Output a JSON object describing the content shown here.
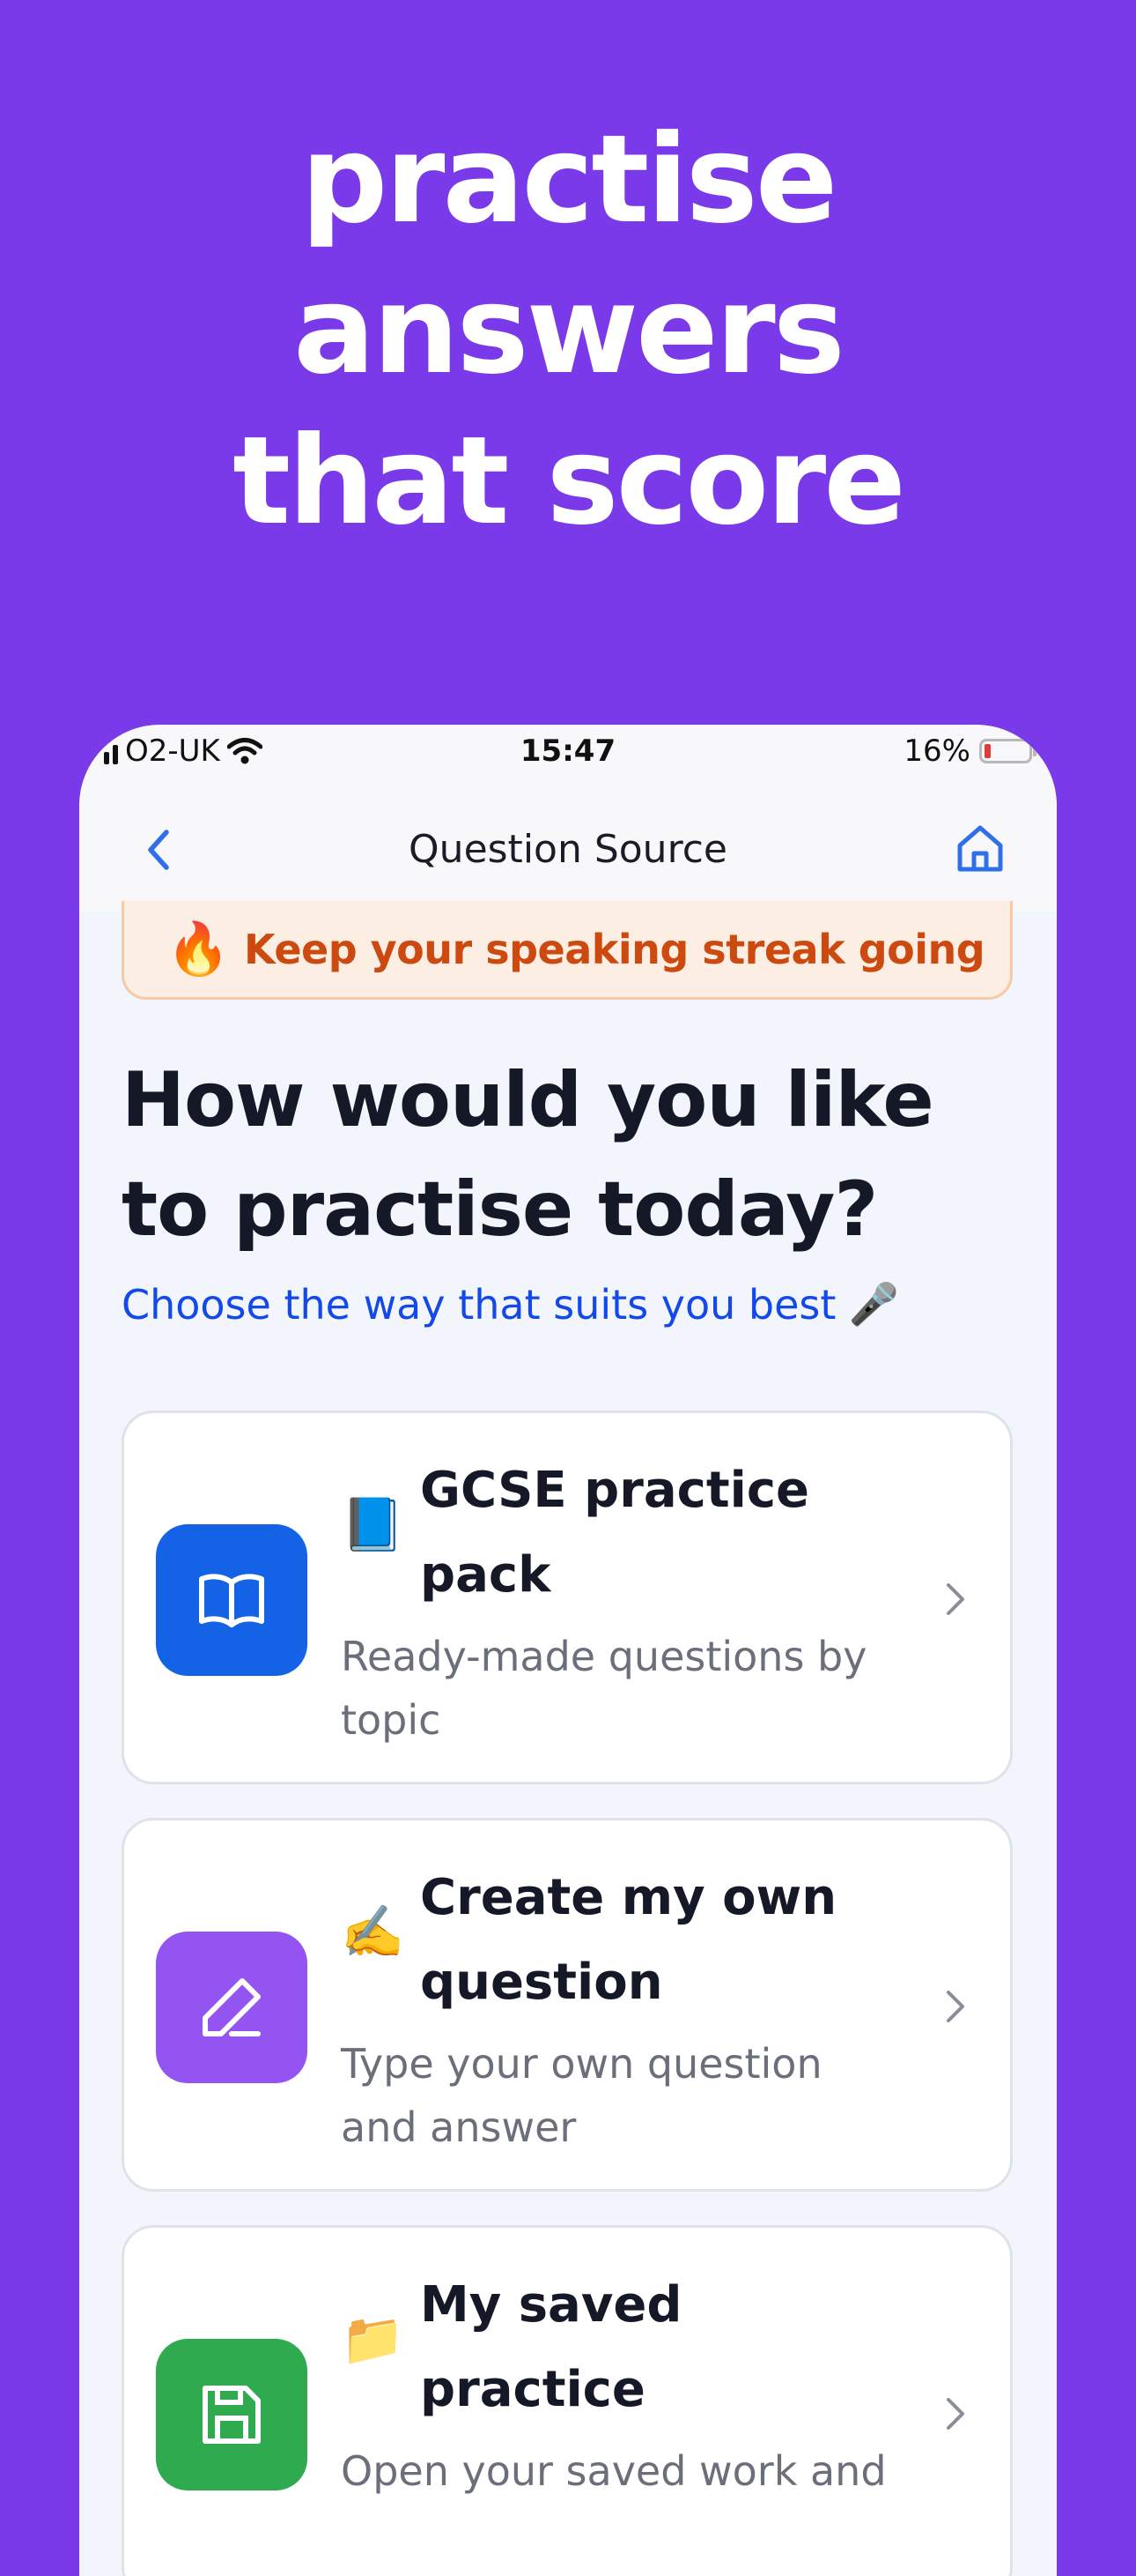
{
  "headline": {
    "lines": [
      "practise",
      "answers",
      "that score"
    ]
  },
  "status_bar": {
    "carrier": "O2-UK",
    "time": "15:47",
    "battery": "16%",
    "battery_level": 0.16
  },
  "nav": {
    "title": "Question Source",
    "back_icon": "chevron-left-icon",
    "home_icon": "home-icon"
  },
  "streak_banner": {
    "emoji": "🔥",
    "text": "Keep your speaking streak going"
  },
  "main": {
    "heading_line1": "How would you like",
    "heading_line2": "to practise today?",
    "subheading": "Choose the way that suits you best",
    "subheading_emoji": "🎤"
  },
  "options": [
    {
      "emoji": "📘",
      "title_line1": "GCSE practice",
      "title_line2": "pack",
      "desc_line1": "Ready-made questions by",
      "desc_line2": "topic",
      "icon": "book-open-icon",
      "color": "#1463e6"
    },
    {
      "emoji": "✍️",
      "title_line1": "Create my own",
      "title_line2": "question",
      "desc_line1": "Type your own question",
      "desc_line2": "and answer",
      "icon": "pencil-icon",
      "color": "#9354f2"
    },
    {
      "emoji": "📁",
      "title_line1": "My saved",
      "title_line2": "practice",
      "desc_line1": "Open your saved work and",
      "desc_line2": "",
      "icon": "save-icon",
      "color": "#2faa4e"
    }
  ]
}
